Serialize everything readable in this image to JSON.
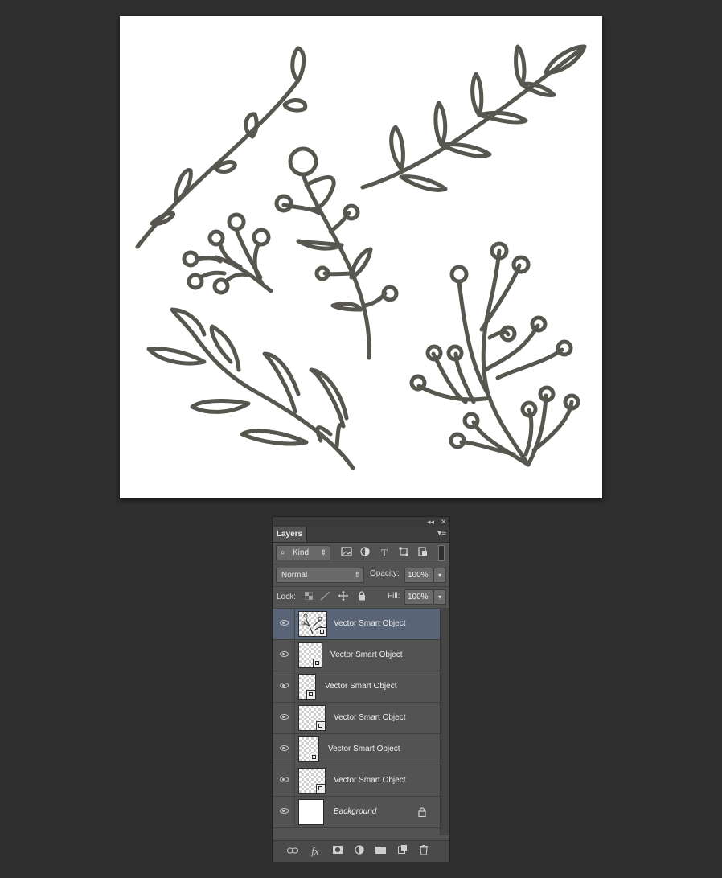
{
  "canvas": {
    "background": "#ffffff",
    "stroke_color": "#57564f"
  },
  "panel": {
    "tab_label": "Layers",
    "collapse_icon": "◂◂",
    "close_icon": "✕",
    "menu_icon": "▾≡",
    "filter": {
      "label": "Kind",
      "search_glyph": "⌕",
      "updown": "⇕"
    },
    "filter_icons": [
      "image-filter-icon",
      "adjustment-filter-icon",
      "type-filter-icon",
      "shape-filter-icon",
      "smart-object-filter-icon"
    ],
    "blend_mode": "Normal",
    "opacity_label": "Opacity:",
    "opacity_value": "100%",
    "lock_label": "Lock:",
    "fill_label": "Fill:",
    "fill_value": "100%",
    "layers": [
      {
        "name": "Vector Smart Object",
        "selected": true
      },
      {
        "name": "Vector Smart Object",
        "selected": false
      },
      {
        "name": "Vector Smart Object",
        "selected": false
      },
      {
        "name": "Vector Smart Object",
        "selected": false
      },
      {
        "name": "Vector Smart Object",
        "selected": false
      },
      {
        "name": "Vector Smart Object",
        "selected": false
      },
      {
        "name": "Background",
        "selected": false
      }
    ],
    "bottom_icons": [
      "link-layers-icon",
      "fx-icon",
      "add-mask-icon",
      "adjustment-layer-icon",
      "new-group-icon",
      "new-layer-icon",
      "delete-layer-icon"
    ],
    "fx_label": "fx"
  }
}
